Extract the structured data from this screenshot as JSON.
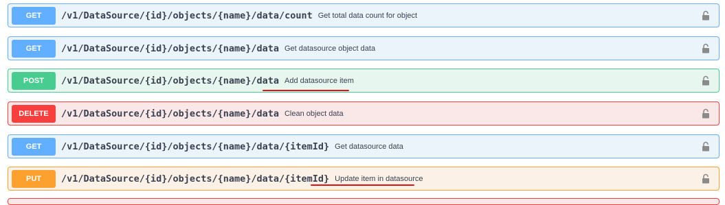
{
  "operations": [
    {
      "method": "GET",
      "path": "/v1/DataSource/{id}/objects/{name}/data/count",
      "summary": "Get total data count for object",
      "lock_icon": "lock-icon"
    },
    {
      "method": "GET",
      "path": "/v1/DataSource/{id}/objects/{name}/data",
      "summary": "Get datasource object data",
      "lock_icon": "lock-icon"
    },
    {
      "method": "POST",
      "path": "/v1/DataSource/{id}/objects/{name}/data",
      "summary": "Add datasource item",
      "lock_icon": "lock-icon"
    },
    {
      "method": "DELETE",
      "path": "/v1/DataSource/{id}/objects/{name}/data",
      "summary": "Clean object data",
      "lock_icon": "lock-icon"
    },
    {
      "method": "GET",
      "path": "/v1/DataSource/{id}/objects/{name}/data/{itemId}",
      "summary": "Get datasource data",
      "lock_icon": "lock-icon"
    },
    {
      "method": "PUT",
      "path": "/v1/DataSource/{id}/objects/{name}/data/{itemId}",
      "summary": "Update item in datasource",
      "lock_icon": "lock-icon"
    }
  ],
  "colors": {
    "get": "#61affe",
    "post": "#49cc90",
    "delete": "#f93e3e",
    "put": "#fca130",
    "annotation": "#dd1111"
  }
}
